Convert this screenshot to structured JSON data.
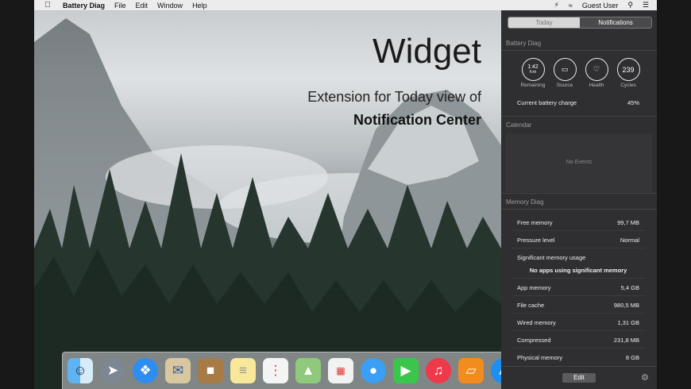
{
  "menubar": {
    "app_name": "Battery Diag",
    "menus": [
      "File",
      "Edit",
      "Window",
      "Help"
    ],
    "user": "Guest User"
  },
  "promo": {
    "headline": "Widget",
    "subline": "Extension for Today view of",
    "subline_bold": "Notification Center"
  },
  "notification_center": {
    "tabs": {
      "today": "Today",
      "notifications": "Notifications"
    },
    "battery": {
      "title": "Battery Diag",
      "gauges": [
        {
          "value": "1:42",
          "unit": "h:m",
          "label": "Remaining"
        },
        {
          "value": "",
          "label": "Source"
        },
        {
          "value": "",
          "label": "Health"
        },
        {
          "value": "239",
          "label": "Cycles"
        }
      ],
      "charge_label": "Current battery charge",
      "charge_value": "45%"
    },
    "calendar": {
      "title": "Calendar",
      "empty": "No Events"
    },
    "memory": {
      "title": "Memory Diag",
      "free_label": "Free memory",
      "free_value": "99,7 MB",
      "pressure_label": "Pressure level",
      "pressure_value": "Normal",
      "significant_label": "Significant memory usage",
      "significant_value": "No apps using significant memory",
      "app_label": "App memory",
      "app_value": "5,4 GB",
      "cache_label": "File cache",
      "cache_value": "980,5 MB",
      "wired_label": "Wired memory",
      "wired_value": "1,31 GB",
      "compressed_label": "Compressed",
      "compressed_value": "231,8 MB",
      "physical_label": "Physical memory",
      "physical_value": "8 GB"
    },
    "edit_label": "Edit"
  },
  "dock": {
    "icons": [
      "finder-icon",
      "launchpad-icon",
      "safari-icon",
      "mail-icon",
      "contacts-icon",
      "notes-icon",
      "reminders-icon",
      "maps-icon",
      "calendar-icon",
      "messages-icon",
      "facetime-icon",
      "itunes-icon",
      "ibooks-icon",
      "app-store-icon"
    ]
  }
}
